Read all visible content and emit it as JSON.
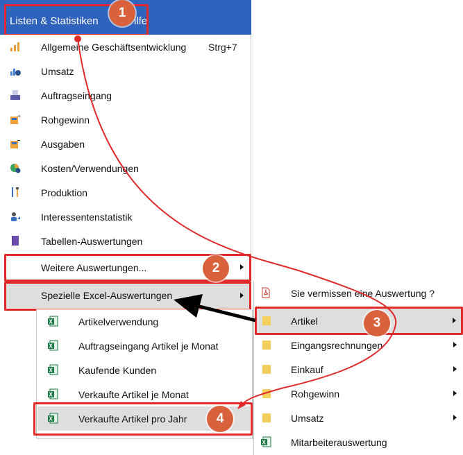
{
  "menubar": {
    "title": "Listen & Statistiken",
    "next_menu_fragment": "ilfe"
  },
  "main_menu": [
    {
      "label": "Allgemeine Geschäftsentwicklung",
      "shortcut": "Strg+7",
      "icon": "bar-chart-icon"
    },
    {
      "label": "Umsatz",
      "icon": "revenue-chart-icon"
    },
    {
      "label": "Auftragseingang",
      "icon": "inbox-icon"
    },
    {
      "label": "Rohgewinn",
      "icon": "gross-profit-icon"
    },
    {
      "label": "Ausgaben",
      "icon": "expenses-icon"
    },
    {
      "label": "Kosten/Verwendungen",
      "icon": "pie-chart-icon"
    },
    {
      "label": "Produktion",
      "icon": "tools-icon"
    },
    {
      "label": "Interessentenstatistik",
      "icon": "person-chart-icon"
    },
    {
      "label": "Tabellen-Auswertungen",
      "icon": "book-icon"
    },
    {
      "label": "Weitere Auswertungen...",
      "has_submenu": true
    },
    {
      "label": "Spezielle Excel-Auswertungen",
      "has_submenu": true,
      "selected": true
    }
  ],
  "excel_submenu": [
    {
      "label": "Artikelverwendung",
      "icon": "excel-icon"
    },
    {
      "label": "Auftragseingang Artikel je Monat",
      "icon": "excel-icon"
    },
    {
      "label": "Kaufende Kunden",
      "icon": "excel-icon"
    },
    {
      "label": "Verkaufte Artikel je Monat",
      "icon": "excel-icon"
    },
    {
      "label": "Verkaufte Artikel pro Jahr",
      "icon": "excel-icon"
    }
  ],
  "right_menu": [
    {
      "label": "Sie vermissen eine Auswertung ?",
      "icon": "pdf-icon"
    },
    {
      "label": "Artikel",
      "icon": "folder-icon",
      "has_submenu": true,
      "selected": true
    },
    {
      "label": "Eingangsrechnungen",
      "icon": "folder-icon",
      "has_submenu": true
    },
    {
      "label": "Einkauf",
      "icon": "folder-icon",
      "has_submenu": true
    },
    {
      "label": "Rohgewinn",
      "icon": "folder-icon",
      "has_submenu": true
    },
    {
      "label": "Umsatz",
      "icon": "folder-icon",
      "has_submenu": true
    },
    {
      "label": "Mitarbeiterauswertung",
      "icon": "excel-icon"
    }
  ],
  "badges": [
    "1",
    "2",
    "3",
    "4"
  ],
  "colors": {
    "menubar": "#2f63be",
    "highlight": "#e02a2a",
    "badge": "#d9623d",
    "selected": "#dedede",
    "folder": "#f5cf5b",
    "excel": "#1d7a45"
  }
}
